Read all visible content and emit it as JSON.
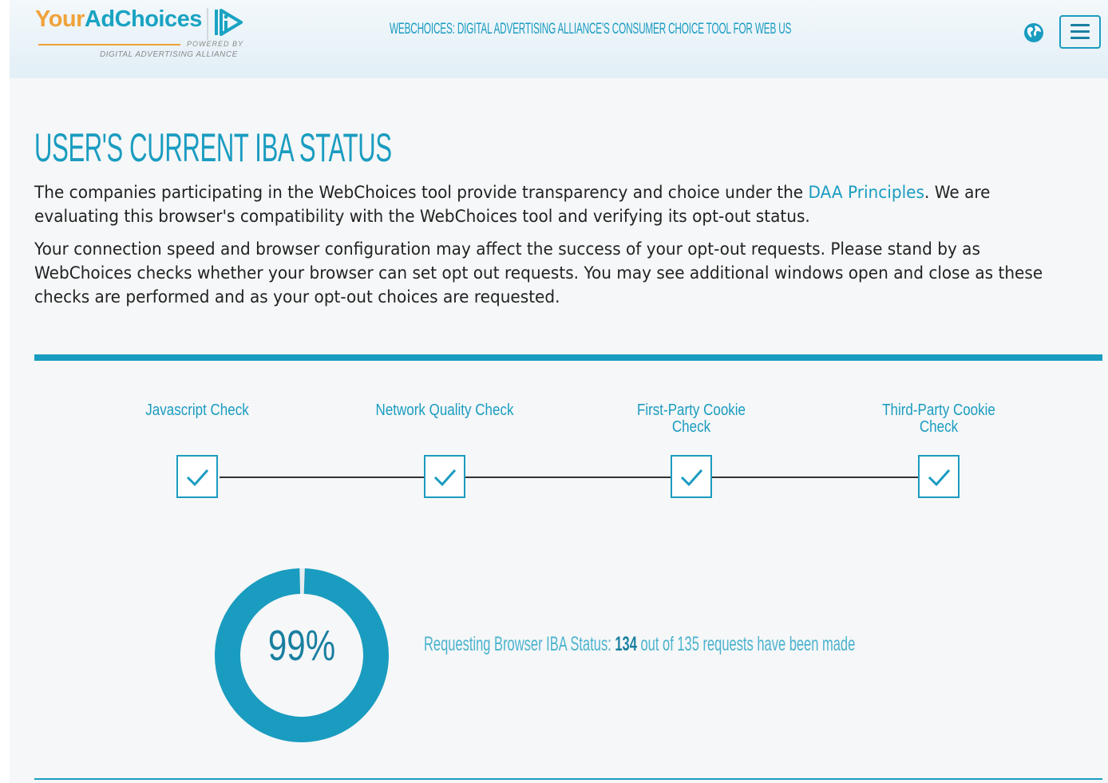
{
  "header": {
    "logo": {
      "brand_your": "Your",
      "brand_adchoices": "AdChoices",
      "powered_by": "POWERED BY",
      "alliance": "DIGITAL ADVERTISING ALLIANCE"
    },
    "title": "WEBCHOICES: DIGITAL ADVERTISING ALLIANCE'S CONSUMER CHOICE TOOL FOR WEB US",
    "globe_icon": "globe-icon",
    "menu_icon": "hamburger-menu-icon"
  },
  "main": {
    "title": "USER'S CURRENT IBA STATUS",
    "para1_before": "The companies participating in the WebChoices tool provide transparency and choice under the ",
    "para1_link": "DAA Principles",
    "para1_after": ". We are evaluating this browser's compatibility with the WebChoices tool and verifying its opt-out status.",
    "para2": "Your connection speed and browser configuration may affect the success of your opt-out requests. Please stand by as WebChoices checks whether your browser can set opt out requests. You may see additional windows open and close as these checks are performed and as your opt-out choices are requested."
  },
  "checks": [
    {
      "label": "Javascript Check",
      "status": "complete",
      "icon": "checkmark-icon"
    },
    {
      "label": "Network Quality Check",
      "status": "complete",
      "icon": "checkmark-icon"
    },
    {
      "label": "First-Party Cookie Check",
      "status": "complete",
      "icon": "checkmark-icon"
    },
    {
      "label": "Third-Party Cookie Check",
      "status": "complete",
      "icon": "checkmark-icon"
    }
  ],
  "progress": {
    "percent_label": "99%",
    "percent": 99,
    "status_prefix": "Requesting Browser IBA Status: ",
    "made": "134",
    "status_suffix": " out of 135 requests have been made"
  },
  "colors": {
    "accent": "#1a9cc0",
    "accent_dark": "#1a7fa0",
    "logo_orange": "#f0a23a"
  }
}
